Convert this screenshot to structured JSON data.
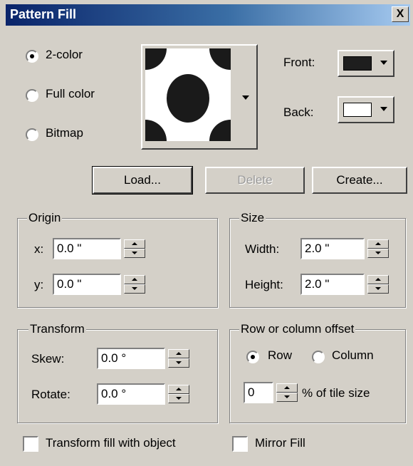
{
  "title": "Pattern Fill",
  "close_glyph": "X",
  "mode_radios": [
    {
      "label": "2-color",
      "selected": true
    },
    {
      "label": "Full color",
      "selected": false
    },
    {
      "label": "Bitmap",
      "selected": false
    }
  ],
  "colors": {
    "front_label": "Front:",
    "back_label": "Back:",
    "front_color": "#1e1e1e",
    "back_color": "#ffffff"
  },
  "buttons": {
    "load": "Load...",
    "delete": "Delete",
    "create": "Create..."
  },
  "origin": {
    "legend": "Origin",
    "x_label": "x:",
    "x_value": "0.0 \"",
    "y_label": "y:",
    "y_value": "0.0 \""
  },
  "size": {
    "legend": "Size",
    "width_label": "Width:",
    "width_value": "2.0 \"",
    "height_label": "Height:",
    "height_value": "2.0 \""
  },
  "transform": {
    "legend": "Transform",
    "skew_label": "Skew:",
    "skew_value": "0.0 °",
    "rotate_label": "Rotate:",
    "rotate_value": "0.0 °"
  },
  "offset": {
    "legend": "Row or column offset",
    "row_label": "Row",
    "column_label": "Column",
    "value": "0",
    "suffix": "% of tile size"
  },
  "checkboxes": {
    "transform_fill": "Transform fill with object",
    "mirror_fill": "Mirror Fill"
  }
}
